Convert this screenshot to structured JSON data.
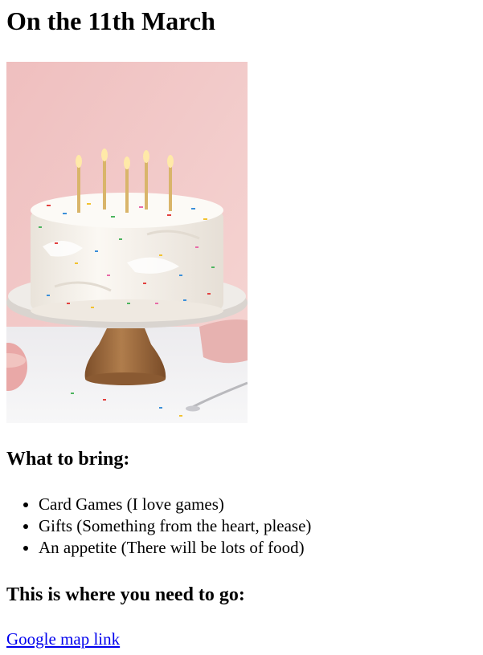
{
  "page": {
    "title": "On the 11th March",
    "hero_image": {
      "alt": "Birthday cake with candles and sprinkles",
      "colors": {
        "background": "#f0c5c5",
        "frosting": "#f6f1ea",
        "wood": "#9a6a3e",
        "plate": "#eeeae5"
      }
    },
    "bring": {
      "heading": "What to bring:",
      "items": [
        "Card Games (I love games)",
        "Gifts (Something from the heart, please)",
        "An appetite (There will be lots of food)"
      ]
    },
    "location": {
      "heading": "This is where you need to go:",
      "link_label": "Google map link"
    }
  }
}
